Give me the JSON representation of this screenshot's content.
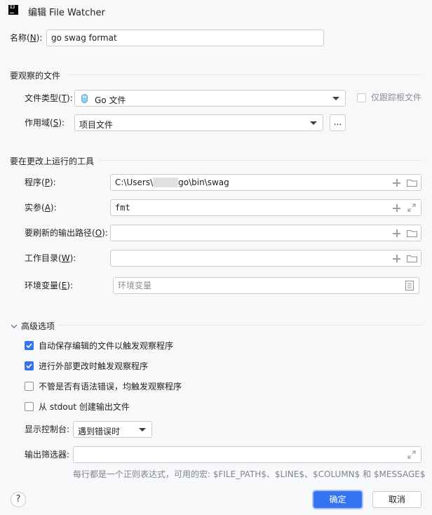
{
  "window": {
    "app_icon_text": "IJ",
    "title": "编辑 File Watcher"
  },
  "name_field": {
    "label": "名称(",
    "mnemonic": "N",
    "label_suffix": "):",
    "value": "go swag format"
  },
  "files_to_watch": {
    "section_title": "要观察的文件",
    "file_type": {
      "label": "文件类型(",
      "mnemonic": "T",
      "label_suffix": "):",
      "value": "Go 文件",
      "icon": "gopher-icon"
    },
    "track_root_only": {
      "label": "仅跟踪根文件",
      "checked": false,
      "enabled": false
    },
    "scope": {
      "label": "作用域(",
      "mnemonic": "S",
      "label_suffix": "):",
      "value": "项目文件",
      "browse_label": "..."
    }
  },
  "tool": {
    "section_title": "要在更改上运行的工具",
    "program": {
      "label": "程序(",
      "mnemonic": "P",
      "label_suffix": "):",
      "value_prefix": "C:\\Users\\",
      "value_suffix": "go\\bin\\swag"
    },
    "arguments": {
      "label": "实参(",
      "mnemonic": "A",
      "label_suffix": "):",
      "value": "fmt"
    },
    "output_paths": {
      "label": "要刷新的输出路径(",
      "mnemonic": "O",
      "label_suffix": "):",
      "value": ""
    },
    "working_dir": {
      "label": "工作目录(",
      "mnemonic": "W",
      "label_suffix": "):",
      "value": ""
    },
    "env_vars": {
      "label": "环境变量(",
      "mnemonic": "E",
      "label_suffix": "):",
      "placeholder": "环境变量"
    }
  },
  "advanced": {
    "section_title": "高级选项",
    "options": [
      {
        "label": "自动保存编辑的文件以触发观察程序",
        "checked": true
      },
      {
        "label": "进行外部更改时触发观察程序",
        "checked": true
      },
      {
        "label": "不管是否有语法错误，均触发观察程序",
        "checked": false
      },
      {
        "label": "从 stdout 创建输出文件",
        "checked": false
      }
    ],
    "show_console": {
      "label": "显示控制台:",
      "value": "遇到错误时"
    },
    "output_filters": {
      "label": "输出筛选器:",
      "value": "",
      "hint": "每行都是一个正则表达式，可用的宏: $FILE_PATH$、$LINE$、$COLUMN$ 和 $MESSAGE$"
    }
  },
  "footer": {
    "help_label": "?",
    "ok_label": "确定",
    "cancel_label": "取消"
  },
  "colors": {
    "accent": "#3574f0",
    "background": "#f7f8fa"
  }
}
